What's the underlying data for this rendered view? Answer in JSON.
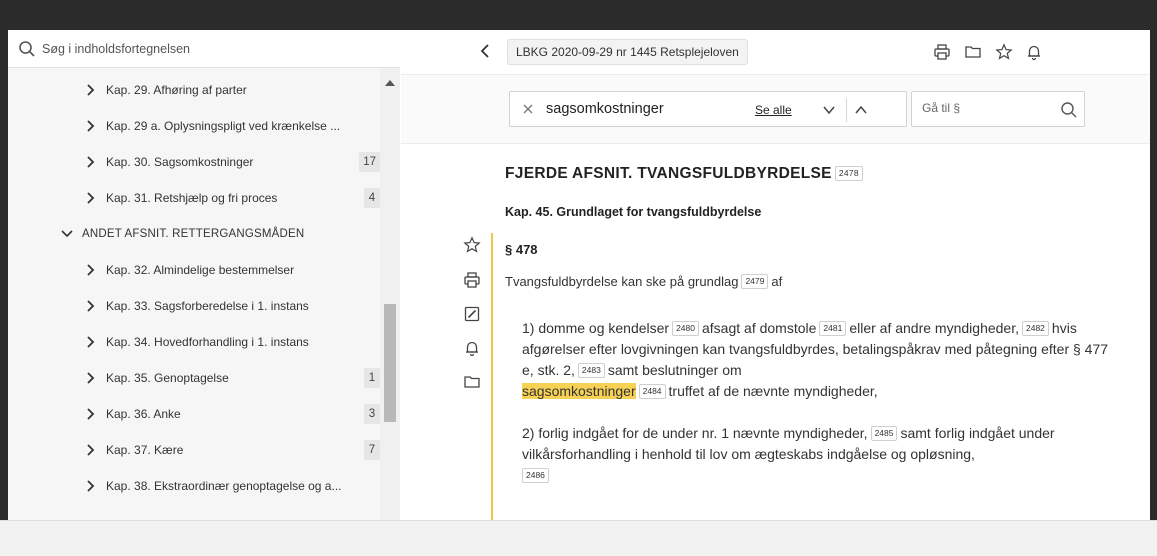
{
  "sidebar": {
    "search_placeholder": "Søg i indholdsfortegnelsen",
    "items": [
      {
        "label": "Kap. 29. Afhøring af parter",
        "badge": "",
        "level": 1,
        "icon": "chevron-right-icon"
      },
      {
        "label": "Kap. 29 a. Oplysningspligt ved krænkelse ...",
        "badge": "",
        "level": 1,
        "icon": "chevron-right-icon"
      },
      {
        "label": "Kap. 30. Sagsomkostninger",
        "badge": "17",
        "level": 1,
        "icon": "chevron-right-icon"
      },
      {
        "label": "Kap. 31. Retshjælp og fri proces",
        "badge": "4",
        "level": 1,
        "icon": "chevron-right-icon"
      },
      {
        "label": "ANDET AFSNIT. RETTERGANGSMÅDEN",
        "badge": "",
        "level": 0,
        "icon": "chevron-down-icon"
      },
      {
        "label": "Kap. 32. Almindelige bestemmelser",
        "badge": "",
        "level": 1,
        "icon": "chevron-right-icon"
      },
      {
        "label": "Kap. 33. Sagsforberedelse i 1. instans",
        "badge": "",
        "level": 1,
        "icon": "chevron-right-icon"
      },
      {
        "label": "Kap. 34. Hovedforhandling i 1. instans",
        "badge": "",
        "level": 1,
        "icon": "chevron-right-icon"
      },
      {
        "label": "Kap. 35. Genoptagelse",
        "badge": "1",
        "level": 1,
        "icon": "chevron-right-icon"
      },
      {
        "label": "Kap. 36. Anke",
        "badge": "3",
        "level": 1,
        "icon": "chevron-right-icon"
      },
      {
        "label": "Kap. 37. Kære",
        "badge": "7",
        "level": 1,
        "icon": "chevron-right-icon"
      },
      {
        "label": "Kap. 38. Ekstraordinær genoptagelse og a...",
        "badge": "",
        "level": 1,
        "icon": "chevron-right-icon"
      }
    ]
  },
  "topbar": {
    "document_title": "LBKG 2020-09-29 nr 1445 Retsplejeloven",
    "icons": [
      "back-chevron-icon",
      "print-icon",
      "folder-icon",
      "star-icon",
      "bell-icon"
    ]
  },
  "search": {
    "term": "sagsomkostninger",
    "see_all": "Se alle",
    "goto_placeholder": "Gå til §"
  },
  "content": {
    "part_title": "FJERDE AFSNIT. TVANGSFULDBYRDELSE",
    "part_ref": "2478",
    "chapter_title": "Kap. 45. Grundlaget for tvangsfuldbyrdelse",
    "section_title": "§ 478",
    "section_lead": "Tvangsfuldbyrdelse kan ske på grundlag",
    "section_lead_ref": "2479",
    "section_lead_tail": "af",
    "para1": {
      "t1": "1) domme og kendelser",
      "r1": "2480",
      "t2": "afsagt af domstole",
      "r2": "2481",
      "t3": "eller af andre myndigheder,",
      "r3": "2482",
      "t4": "hvis afgørelser efter lovgivningen kan tvangsfuldbyrdes, betalingspåkrav med påtegning efter § 477 e, stk. 2,",
      "r4": "2483",
      "t5": "samt beslutninger om",
      "highlight": "sagsomkostninger",
      "r5": "2484",
      "t6": "truffet af de nævnte myndigheder,"
    },
    "para2": {
      "t1": "2) forlig indgået for de under nr. 1 nævnte myndigheder,",
      "r1": "2485",
      "t2": "samt forlig indgået under vilkårsforhandling i henhold til lov om ægteskabs indgåelse og opløsning,",
      "r2": "2486"
    },
    "side_tools": [
      "star-outline-icon",
      "print-icon",
      "edit-note-icon",
      "bell-icon",
      "folder-icon"
    ]
  },
  "colors": {
    "highlight": "#f7d154",
    "section_bar": "#f3c64b"
  }
}
